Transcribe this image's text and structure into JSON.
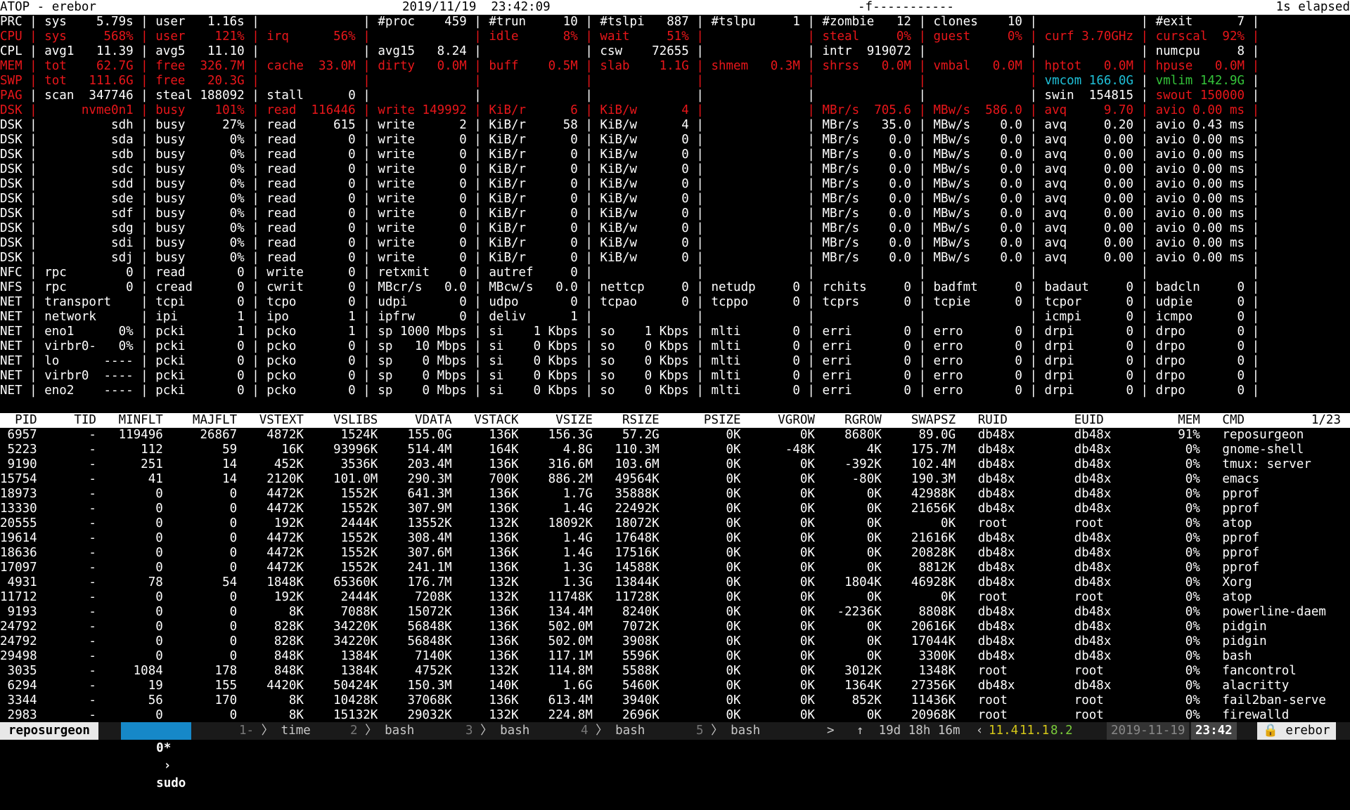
{
  "titlebar": {
    "left": "ATOP - erebor",
    "datetime": "2019/11/19  23:42:09",
    "flags": "-f-----------",
    "elapsed": "1s elapsed"
  },
  "sysrows": [
    {
      "t": "PRC | sys    5.79s | user   1.16s |              | #proc    459 | #trun     10 | #tslpi   887 | #tslpu     1 | #zombie   12 | clones    10 |              | #exit      7 |",
      "c": "w"
    },
    {
      "t": "CPU | sys     568% | user    121% | irq      56% |              | idle      8% | wait     51% |              | steal     0% | guest     0% | curf 3.70GHz | curscal  92% |",
      "c": "r"
    },
    {
      "t": "CPL | avg1   11.39 | avg5   11.10 |              | avg15   8.24 |              | csw    72655 |              | intr  919072 |              |              | numcpu     8 |",
      "c": "w"
    },
    {
      "t": "MEM | tot    62.7G | free  326.7M | cache  33.0M | dirty   0.0M | buff    0.5M | slab    1.1G | shmem   0.3M | shrss   0.0M | vmbal   0.0M | hptot   0.0M | hpuse   0.0M |",
      "c": "r"
    },
    {
      "t": "SWP | tot   111.6G | free   20.3G |              |              |              |              |              |              |              | vmcom 166.0G | vmlim 142.9G |",
      "c": "swp"
    },
    {
      "t": "PAG | scan  347746 | steal 188092 | stall      0 |              |              |              |              |              |              | swin  154815 | swout 150000 |",
      "c": "pag"
    },
    {
      "t": "DSK |      nvme0n1 | busy    101% | read  116446 | write 149992 | KiB/r      6 | KiB/w      4 |              | MBr/s  705.6 | MBw/s  586.0 | avq     9.70 | avio 0.00 ms |",
      "c": "dskr"
    },
    {
      "t": "DSK |          sdh | busy     27% | read     615 | write      2 | KiB/r     58 | KiB/w      4 |              | MBr/s   35.0 | MBw/s    0.0 | avq     0.20 | avio 0.43 ms |",
      "c": "w"
    },
    {
      "t": "DSK |          sda | busy      0% | read       0 | write      0 | KiB/r      0 | KiB/w      0 |              | MBr/s    0.0 | MBw/s    0.0 | avq     0.00 | avio 0.00 ms |",
      "c": "w"
    },
    {
      "t": "DSK |          sdb | busy      0% | read       0 | write      0 | KiB/r      0 | KiB/w      0 |              | MBr/s    0.0 | MBw/s    0.0 | avq     0.00 | avio 0.00 ms |",
      "c": "w"
    },
    {
      "t": "DSK |          sdc | busy      0% | read       0 | write      0 | KiB/r      0 | KiB/w      0 |              | MBr/s    0.0 | MBw/s    0.0 | avq     0.00 | avio 0.00 ms |",
      "c": "w"
    },
    {
      "t": "DSK |          sdd | busy      0% | read       0 | write      0 | KiB/r      0 | KiB/w      0 |              | MBr/s    0.0 | MBw/s    0.0 | avq     0.00 | avio 0.00 ms |",
      "c": "w"
    },
    {
      "t": "DSK |          sde | busy      0% | read       0 | write      0 | KiB/r      0 | KiB/w      0 |              | MBr/s    0.0 | MBw/s    0.0 | avq     0.00 | avio 0.00 ms |",
      "c": "w"
    },
    {
      "t": "DSK |          sdf | busy      0% | read       0 | write      0 | KiB/r      0 | KiB/w      0 |              | MBr/s    0.0 | MBw/s    0.0 | avq     0.00 | avio 0.00 ms |",
      "c": "w"
    },
    {
      "t": "DSK |          sdg | busy      0% | read       0 | write      0 | KiB/r      0 | KiB/w      0 |              | MBr/s    0.0 | MBw/s    0.0 | avq     0.00 | avio 0.00 ms |",
      "c": "w"
    },
    {
      "t": "DSK |          sdi | busy      0% | read       0 | write      0 | KiB/r      0 | KiB/w      0 |              | MBr/s    0.0 | MBw/s    0.0 | avq     0.00 | avio 0.00 ms |",
      "c": "w"
    },
    {
      "t": "DSK |          sdj | busy      0% | read       0 | write      0 | KiB/r      0 | KiB/w      0 |              | MBr/s    0.0 | MBw/s    0.0 | avq     0.00 | avio 0.00 ms |",
      "c": "w"
    },
    {
      "t": "NFC | rpc        0 | read       0 | write      0 | retxmit    0 | autref     0 |              |              |              |              |              |              |",
      "c": "w"
    },
    {
      "t": "NFS | rpc        0 | cread      0 | cwrit      0 | MBcr/s   0.0 | MBcw/s   0.0 | nettcp     0 | netudp     0 | rchits     0 | badfmt     0 | badaut     0 | badcln     0 |",
      "c": "w"
    },
    {
      "t": "NET | transport    | tcpi       0 | tcpo       0 | udpi       0 | udpo       0 | tcpao      0 | tcppo      0 | tcprs      0 | tcpie      0 | tcpor      0 | udpie      0 |",
      "c": "w"
    },
    {
      "t": "NET | network      | ipi        1 | ipo        1 | ipfrw      0 | deliv      1 |              |              |              |              | icmpi      0 | icmpo      0 |",
      "c": "w"
    },
    {
      "t": "NET | eno1      0% | pcki       1 | pcko       1 | sp 1000 Mbps | si    1 Kbps | so    1 Kbps | mlti       0 | erri       0 | erro       0 | drpi       0 | drpo       0 |",
      "c": "w"
    },
    {
      "t": "NET | virbr0-   0% | pcki       0 | pcko       0 | sp   10 Mbps | si    0 Kbps | so    0 Kbps | mlti       0 | erri       0 | erro       0 | drpi       0 | drpo       0 |",
      "c": "w"
    },
    {
      "t": "NET | lo      ---- | pcki       0 | pcko       0 | sp    0 Mbps | si    0 Kbps | so    0 Kbps | mlti       0 | erri       0 | erro       0 | drpi       0 | drpo       0 |",
      "c": "w"
    },
    {
      "t": "NET | virbr0  ---- | pcki       0 | pcko       0 | sp    0 Mbps | si    0 Kbps | so    0 Kbps | mlti       0 | erri       0 | erro       0 | drpi       0 | drpo       0 |",
      "c": "w"
    },
    {
      "t": "NET | eno2    ---- | pcki       0 | pcko       0 | sp    0 Mbps | si    0 Kbps | so    0 Kbps | mlti       0 | erri       0 | erro       0 | drpi       0 | drpo       0 |",
      "c": "w"
    }
  ],
  "proc_header": "  PID     TID   MINFLT    MAJFLT   VSTEXT    VSLIBS     VDATA   VSTACK     VSIZE    RSIZE      PSIZE     VGROW    RGROW    SWAPSZ   RUID         EUID          MEM   CMD         1/23",
  "procs": [
    " 6957       -   119496     26867    4872K     1524K    155.0G     136K    156.3G    57.2G         0K        0K    8680K     89.0G   db48x        db48x         91%   reposurgeon",
    " 5223       -      112        59      16K    93996K    514.4M     164K      4.8G   110.3M         0K      -48K       4K    175.7M   db48x        db48x          0%   gnome-shell",
    " 9190       -      251        14     452K     3536K    203.4M     136K    316.6M   103.6M         0K        0K    -392K    102.4M   db48x        db48x          0%   tmux: server",
    "15754       -       41        14    2120K    101.0M    290.3M     700K    886.2M   49564K         0K        0K     -80K    190.3M   db48x        db48x          0%   emacs",
    "18973       -        0         0    4472K     1552K    641.3M     136K      1.7G   35888K         0K        0K       0K    42988K   db48x        db48x          0%   pprof",
    "13330       -        0         0    4472K     1552K    307.9M     136K      1.4G   22492K         0K        0K       0K    21656K   db48x        db48x          0%   pprof",
    "20555       -        0         0     192K     2444K    13552K     132K    18092K   18072K         0K        0K       0K        0K   root         root           0%   atop",
    "19614       -        0         0    4472K     1552K    308.4M     136K      1.4G   17648K         0K        0K       0K    21616K   db48x        db48x          0%   pprof",
    "18636       -        0         0    4472K     1552K    307.6M     136K      1.4G   17516K         0K        0K       0K    20828K   db48x        db48x          0%   pprof",
    "17097       -        0         0    4472K     1552K    241.1M     136K      1.3G   14588K         0K        0K       0K     8812K   db48x        db48x          0%   pprof",
    " 4931       -       78        54    1848K    65360K    176.7M     132K      1.3G   13844K         0K        0K    1804K    46928K   db48x        db48x          0%   Xorg",
    "11712       -        0         0     192K     2444K     7208K     132K    11748K   11728K         0K        0K       0K        0K   root         root           0%   atop",
    " 9193       -        0         0       8K     7088K    15072K     136K    134.4M    8240K         0K        0K   -2236K     8808K   db48x        db48x          0%   powerline-daem",
    "24792       -        0         0     828K    34220K    56848K     136K    502.0M    7072K         0K        0K       0K    20616K   db48x        db48x          0%   pidgin",
    "24792       -        0         0     828K    34220K    56848K     136K    502.0M    3908K         0K        0K       0K    17044K   db48x        db48x          0%   pidgin",
    "29498       -        0         0     848K     1384K     7140K     136K    117.1M    5596K         0K        0K       0K     3300K   db48x        db48x          0%   bash",
    " 3035       -     1084       178     848K     1384K     4752K     132K    114.8M    5588K         0K        0K    3012K     1348K   root         root           0%   fancontrol",
    " 6294       -       19       155    4420K    50424K    150.3M     140K      1.6G    5460K         0K        0K    1364K    27356K   db48x        db48x          0%   alacritty",
    " 3344       -       56       170       8K    10428K    37068K     136K    613.4M    3940K         0K        0K     852K    11436K   root         root           0%   fail2ban-serve",
    " 2983       -        0         0       8K    15132K    29032K     132K    224.8M    2696K         0K        0K       0K    20968K   root         root           0%   firewalld"
  ],
  "statusbar": {
    "session": "reposurgeon",
    "active_num": "0*",
    "active_name": "sudo",
    "windows": [
      {
        "num": "1-",
        "name": "time"
      },
      {
        "num": "2",
        "name": "bash"
      },
      {
        "num": "3",
        "name": "bash"
      },
      {
        "num": "4",
        "name": "bash"
      },
      {
        "num": "5",
        "name": "bash"
      }
    ],
    "more": ">",
    "uptime": "↑  19d 18h 16m",
    "load1": "11.4",
    "load5": "11.1",
    "load15": "8.2",
    "date": "2019-11-19",
    "time": "23:42",
    "host": "🔒 erebor"
  },
  "colors": {
    "red": "#e8161a",
    "cyan": "#1fc0d8",
    "green": "#34c33a",
    "active_window": "#1688c8"
  }
}
